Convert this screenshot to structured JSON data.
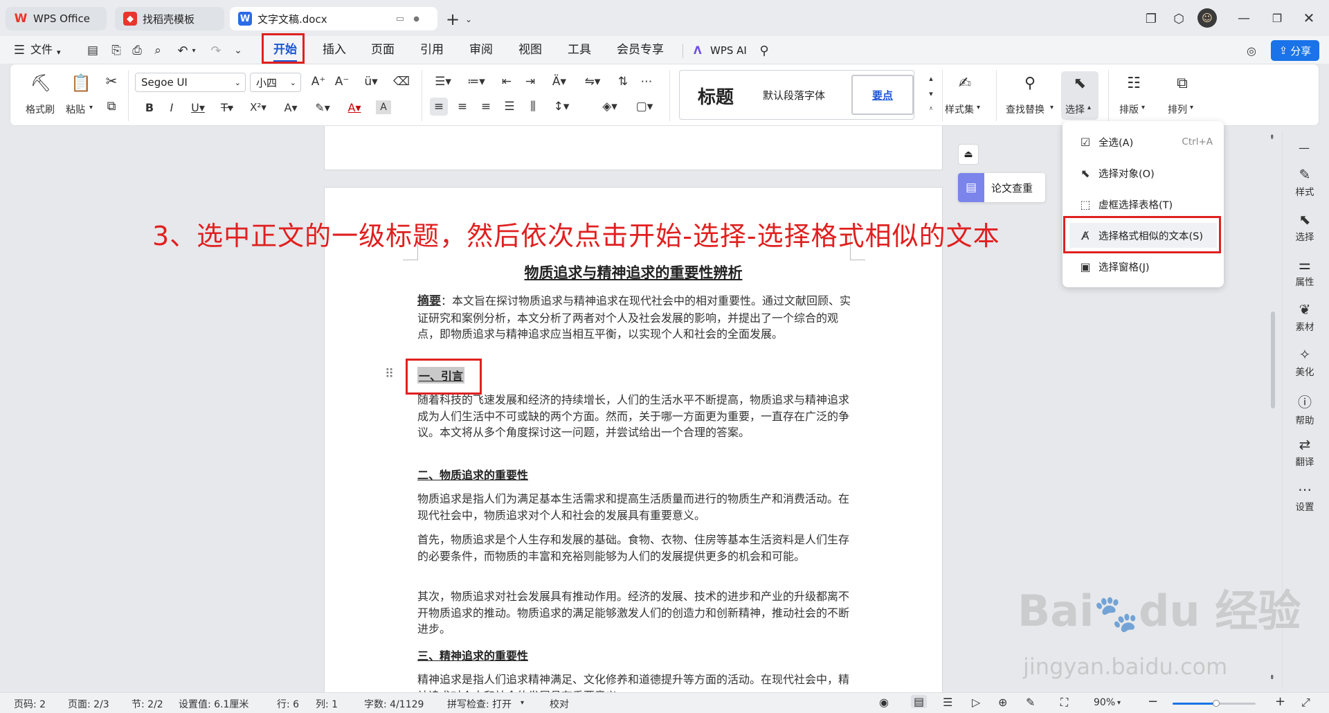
{
  "tabs": {
    "wps": "WPS Office",
    "template": "找稻壳模板",
    "document": "文字文稿.docx"
  },
  "menu": {
    "file": "文件",
    "items": [
      "开始",
      "插入",
      "页面",
      "引用",
      "审阅",
      "视图",
      "工具",
      "会员专享"
    ],
    "wps_ai": "WPS AI",
    "share": "分享"
  },
  "ribbon": {
    "format_painter": "格式刷",
    "paste": "粘贴",
    "font_name": "Segoe UI",
    "font_size": "小四",
    "styles": [
      "标题",
      "默认段落字体",
      "要点"
    ],
    "style_set": "样式集",
    "find_replace": "查找替换",
    "select": "选择",
    "layout": "排版",
    "arrange": "排列"
  },
  "instruction": "3、选中正文的一级标题，然后依次点击开始-选择-选择格式相似的文本",
  "side_button": "论文查重",
  "document": {
    "title": "物质追求与精神追求的重要性辨析",
    "abstract_label": "摘要",
    "abstract": "：本文旨在探讨物质追求与精神追求在现代社会中的相对重要性。通过文献回顾、实证研究和案例分析，本文分析了两者对个人及社会发展的影响，并提出了一个综合的观点，即物质追求与精神追求应当相互平衡，以实现个人和社会的全面发展。",
    "h1": "一、引言",
    "p1": "随着科技的飞速发展和经济的持续增长，人们的生活水平不断提高，物质追求与精神追求成为人们生活中不可或缺的两个方面。然而，关于哪一方面更为重要，一直存在广泛的争议。本文将从多个角度探讨这一问题，并尝试给出一个合理的答案。",
    "h2": "二、物质追求的重要性",
    "p2": "物质追求是指人们为满足基本生活需求和提高生活质量而进行的物质生产和消费活动。在现代社会中，物质追求对个人和社会的发展具有重要意义。",
    "p3": "首先，物质追求是个人生存和发展的基础。食物、衣物、住房等基本生活资料是人们生存的必要条件，而物质的丰富和充裕则能够为人们的发展提供更多的机会和可能。",
    "p4": "其次，物质追求对社会发展具有推动作用。经济的发展、技术的进步和产业的升级都离不开物质追求的推动。物质追求的满足能够激发人们的创造力和创新精神，推动社会的不断进步。",
    "h3": "三、精神追求的重要性",
    "p5": "精神追求是指人们追求精神满足、文化修养和道德提升等方面的活动。在现代社会中，精神追求对个人和社会的发展具有重要意义。"
  },
  "dropdown": [
    {
      "label": "全选(A)",
      "shortcut": "Ctrl+A"
    },
    {
      "label": "选择对象(O)",
      "shortcut": ""
    },
    {
      "label": "虚框选择表格(T)",
      "shortcut": ""
    },
    {
      "label": "选择格式相似的文本(S)",
      "shortcut": ""
    },
    {
      "label": "选择窗格(J)",
      "shortcut": ""
    }
  ],
  "right_sidebar": [
    "样式",
    "选择",
    "属性",
    "素材",
    "美化",
    "帮助",
    "翻译",
    "设置"
  ],
  "status": {
    "page_no": "页码: 2",
    "pages": "页面: 2/3",
    "section": "节: 2/2",
    "setting": "设置值: 6.1厘米",
    "row": "行: 6",
    "col": "列: 1",
    "words": "字数: 4/1129",
    "spell": "拼写检查: 打开",
    "proof": "校对",
    "zoom": "90%"
  },
  "watermark": {
    "logo": "Bai du 经验",
    "url": "jingyan.baidu.com"
  },
  "colors": {
    "accent": "#1a73e8",
    "red_annotation": "#e02020",
    "wps_red": "#e8352e"
  }
}
